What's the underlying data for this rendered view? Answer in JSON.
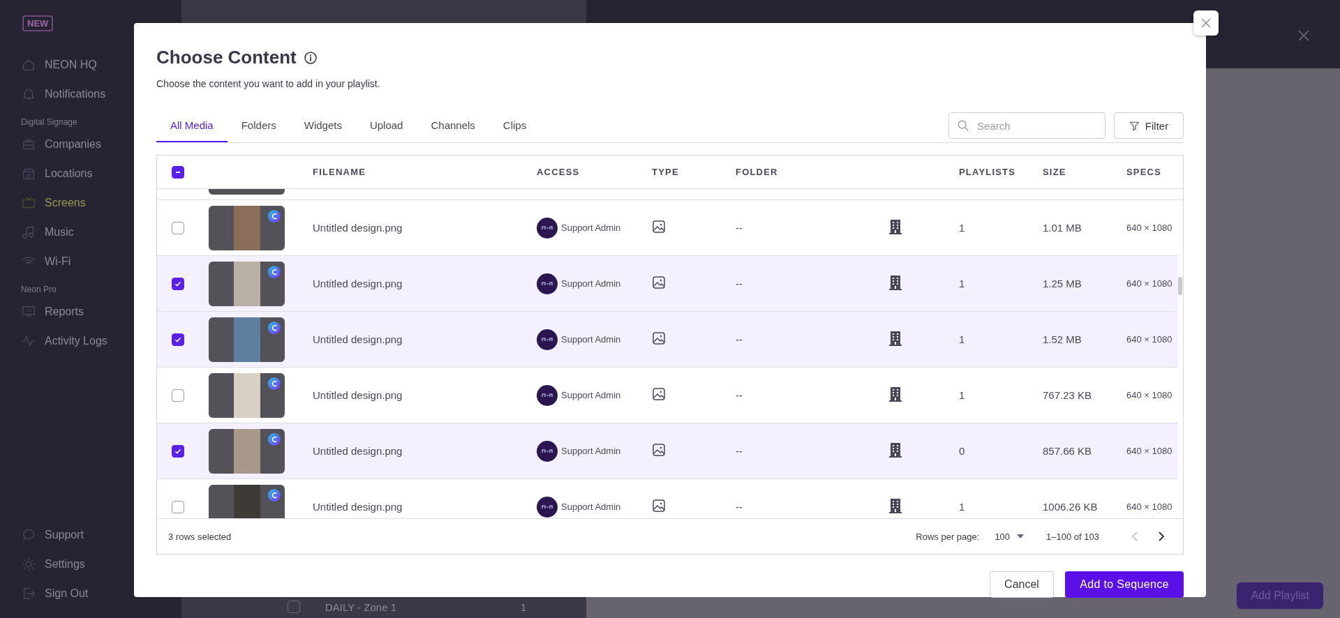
{
  "sidebar": {
    "badge": "NEW",
    "items": [
      {
        "kind": "item",
        "label": "NEON HQ",
        "selected": false
      },
      {
        "kind": "item",
        "label": "Notifications",
        "selected": false
      },
      {
        "kind": "section",
        "label": "Digital Signage"
      },
      {
        "kind": "item",
        "label": "Companies",
        "selected": false
      },
      {
        "kind": "item",
        "label": "Locations",
        "selected": false
      },
      {
        "kind": "item",
        "label": "Screens",
        "selected": true
      },
      {
        "kind": "item",
        "label": "Music",
        "selected": false
      },
      {
        "kind": "item",
        "label": "Wi-Fi",
        "selected": false
      },
      {
        "kind": "section",
        "label": "Neon Pro"
      },
      {
        "kind": "item",
        "label": "Reports",
        "selected": false
      },
      {
        "kind": "item",
        "label": "Activity Logs",
        "selected": false
      }
    ],
    "bottom_items": [
      "Support",
      "Settings",
      "Sign Out"
    ]
  },
  "background_list": {
    "checked": false,
    "name": "DAILY - Zone 1",
    "count": "1"
  },
  "background_panel": {
    "primary_button": "Add Playlist"
  },
  "dialog": {
    "title": "Choose Content",
    "subtitle": "Choose the content you want to add in your playlist.",
    "tabs": [
      {
        "label": "All Media",
        "selected": true
      },
      {
        "label": "Folders",
        "selected": false
      },
      {
        "label": "Widgets",
        "selected": false
      },
      {
        "label": "Upload",
        "selected": false
      },
      {
        "label": "Channels",
        "selected": false
      },
      {
        "label": "Clips",
        "selected": false
      }
    ],
    "search": {
      "placeholder": "Search"
    },
    "filter_button": "Filter",
    "table": {
      "select_all_indeterminate": true,
      "columns": [
        "FILENAME",
        "ACCESS",
        "TYPE",
        "FOLDER",
        "PLAYLISTS",
        "SIZE",
        "SPECS"
      ],
      "rows": [
        {
          "checked": false,
          "filename": "Untitled design.png",
          "access": "Support Admin",
          "folder": "--",
          "playlists": "1",
          "size": "1.01 MB",
          "specs": "640 × 1080"
        },
        {
          "checked": true,
          "filename": "Untitled design.png",
          "access": "Support Admin",
          "folder": "--",
          "playlists": "1",
          "size": "1.25 MB",
          "specs": "640 × 1080"
        },
        {
          "checked": true,
          "filename": "Untitled design.png",
          "access": "Support Admin",
          "folder": "--",
          "playlists": "1",
          "size": "1.52 MB",
          "specs": "640 × 1080"
        },
        {
          "checked": false,
          "filename": "Untitled design.png",
          "access": "Support Admin",
          "folder": "--",
          "playlists": "1",
          "size": "767.23 KB",
          "specs": "640 × 1080"
        },
        {
          "checked": true,
          "filename": "Untitled design.png",
          "access": "Support Admin",
          "folder": "--",
          "playlists": "0",
          "size": "857.66 KB",
          "specs": "640 × 1080"
        },
        {
          "checked": false,
          "filename": "Untitled design.png",
          "access": "Support Admin",
          "folder": "--",
          "playlists": "1",
          "size": "1006.26 KB",
          "specs": "640 × 1080"
        }
      ],
      "footer": {
        "selection": "3 rows selected",
        "rows_per_page_label": "Rows per page:",
        "rows_per_page": "100",
        "range": "1–100 of 103",
        "prev_disabled": true,
        "next_disabled": false
      }
    },
    "buttons": [
      {
        "kind": "secondary",
        "label": "Cancel"
      },
      {
        "kind": "primary",
        "label": "Add to Sequence"
      }
    ]
  }
}
